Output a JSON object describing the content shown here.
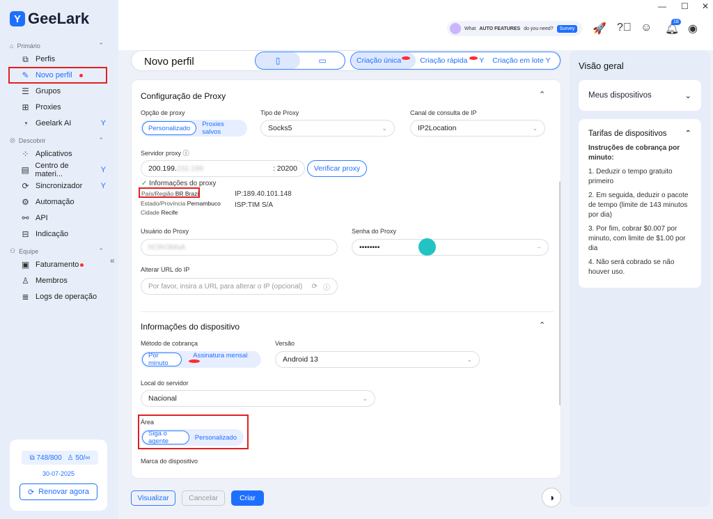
{
  "app": {
    "name": "GeeLark"
  },
  "window": {
    "minimize": "—",
    "maximize": "☐",
    "close": "✕"
  },
  "sidebar": {
    "sections": [
      {
        "label": "Primário"
      },
      {
        "label": "Descobrir"
      },
      {
        "label": "Equipe"
      }
    ],
    "items": [
      {
        "label": "Perfis"
      },
      {
        "label": "Novo perfil"
      },
      {
        "label": "Grupos"
      },
      {
        "label": "Proxies"
      },
      {
        "label": "Geelark AI"
      },
      {
        "label": "Aplicativos"
      },
      {
        "label": "Centro de materi..."
      },
      {
        "label": "Sincronizador"
      },
      {
        "label": "Automação"
      },
      {
        "label": "API"
      },
      {
        "label": "Indicação"
      },
      {
        "label": "Faturamento"
      },
      {
        "label": "Membros"
      },
      {
        "label": "Logs de operação"
      }
    ],
    "plan": {
      "profiles": "748/800",
      "members": "50/∞",
      "date": "30-07-2025",
      "renew": "Renovar agora"
    }
  },
  "topbar": {
    "survey_prefix": "What",
    "survey_bold": "AUTO FEATURES",
    "survey_suffix": "do you need?",
    "survey_button": "Survey",
    "notif_count": "18"
  },
  "header": {
    "title": "Novo perfil",
    "modes": [
      "Criação única",
      "Criação rápida",
      "Criação em lote"
    ]
  },
  "proxy": {
    "section_title": "Configuração de Proxy",
    "option_label": "Opção de proxy",
    "option_values": [
      "Personalizado",
      "Proxies salvos"
    ],
    "type_label": "Tipo de Proxy",
    "type_value": "Socks5",
    "channel_label": "Canal de consulta de IP",
    "channel_value": "IP2Location",
    "server_label": "Servidor proxy",
    "server_value": "200.199.",
    "server_hidden": "152.199",
    "port_value": ": 20200",
    "verify_button": "Verificar proxy",
    "info_title": "Informações do proxy",
    "country_label": "País/Região",
    "country_value": "BR Brazil",
    "state_label": "Estado/Província",
    "state_value": "Pernambuco",
    "city_label": "Cidade",
    "city_value": "Recife",
    "ip_value": "IP:189.40.101.148",
    "isp_value": "ISP:TIM S/A",
    "user_label": "Usuário do Proxy",
    "user_value": "hC9V3MsA",
    "password_label": "Senha do Proxy",
    "password_value": "••••••••",
    "url_label": "Alterar URL do IP",
    "url_placeholder": "Por favor, insira a URL para alterar o IP (opcional)"
  },
  "device": {
    "section_title": "Informações do dispositivo",
    "billing_label": "Método de cobrança",
    "billing_values": [
      "Por minuto",
      "Assinatura mensal"
    ],
    "version_label": "Versão",
    "version_value": "Android 13",
    "server_label": "Local do servidor",
    "server_value": "Nacional",
    "area_label": "Área",
    "area_values": [
      "Siga o agente",
      "Personalizado"
    ],
    "brand_label": "Marca do dispositivo"
  },
  "footer": {
    "preview": "Visualizar",
    "cancel": "Cancelar",
    "create": "Criar"
  },
  "overview": {
    "title": "Visão geral",
    "devices": "Meus dispositivos",
    "rates_title": "Tarifas de dispositivos",
    "rates_intro": "Instruções de cobrança por minuto:",
    "rates": [
      "1. Deduzir o tempo gratuito primeiro",
      "2. Em seguida, deduzir o pacote de tempo (limite de 143 minutos por dia)",
      "3. Por fim, cobrar $0.007 por minuto, com limite de $1.00 por dia",
      "4. Não será cobrado se não houver uso."
    ]
  }
}
